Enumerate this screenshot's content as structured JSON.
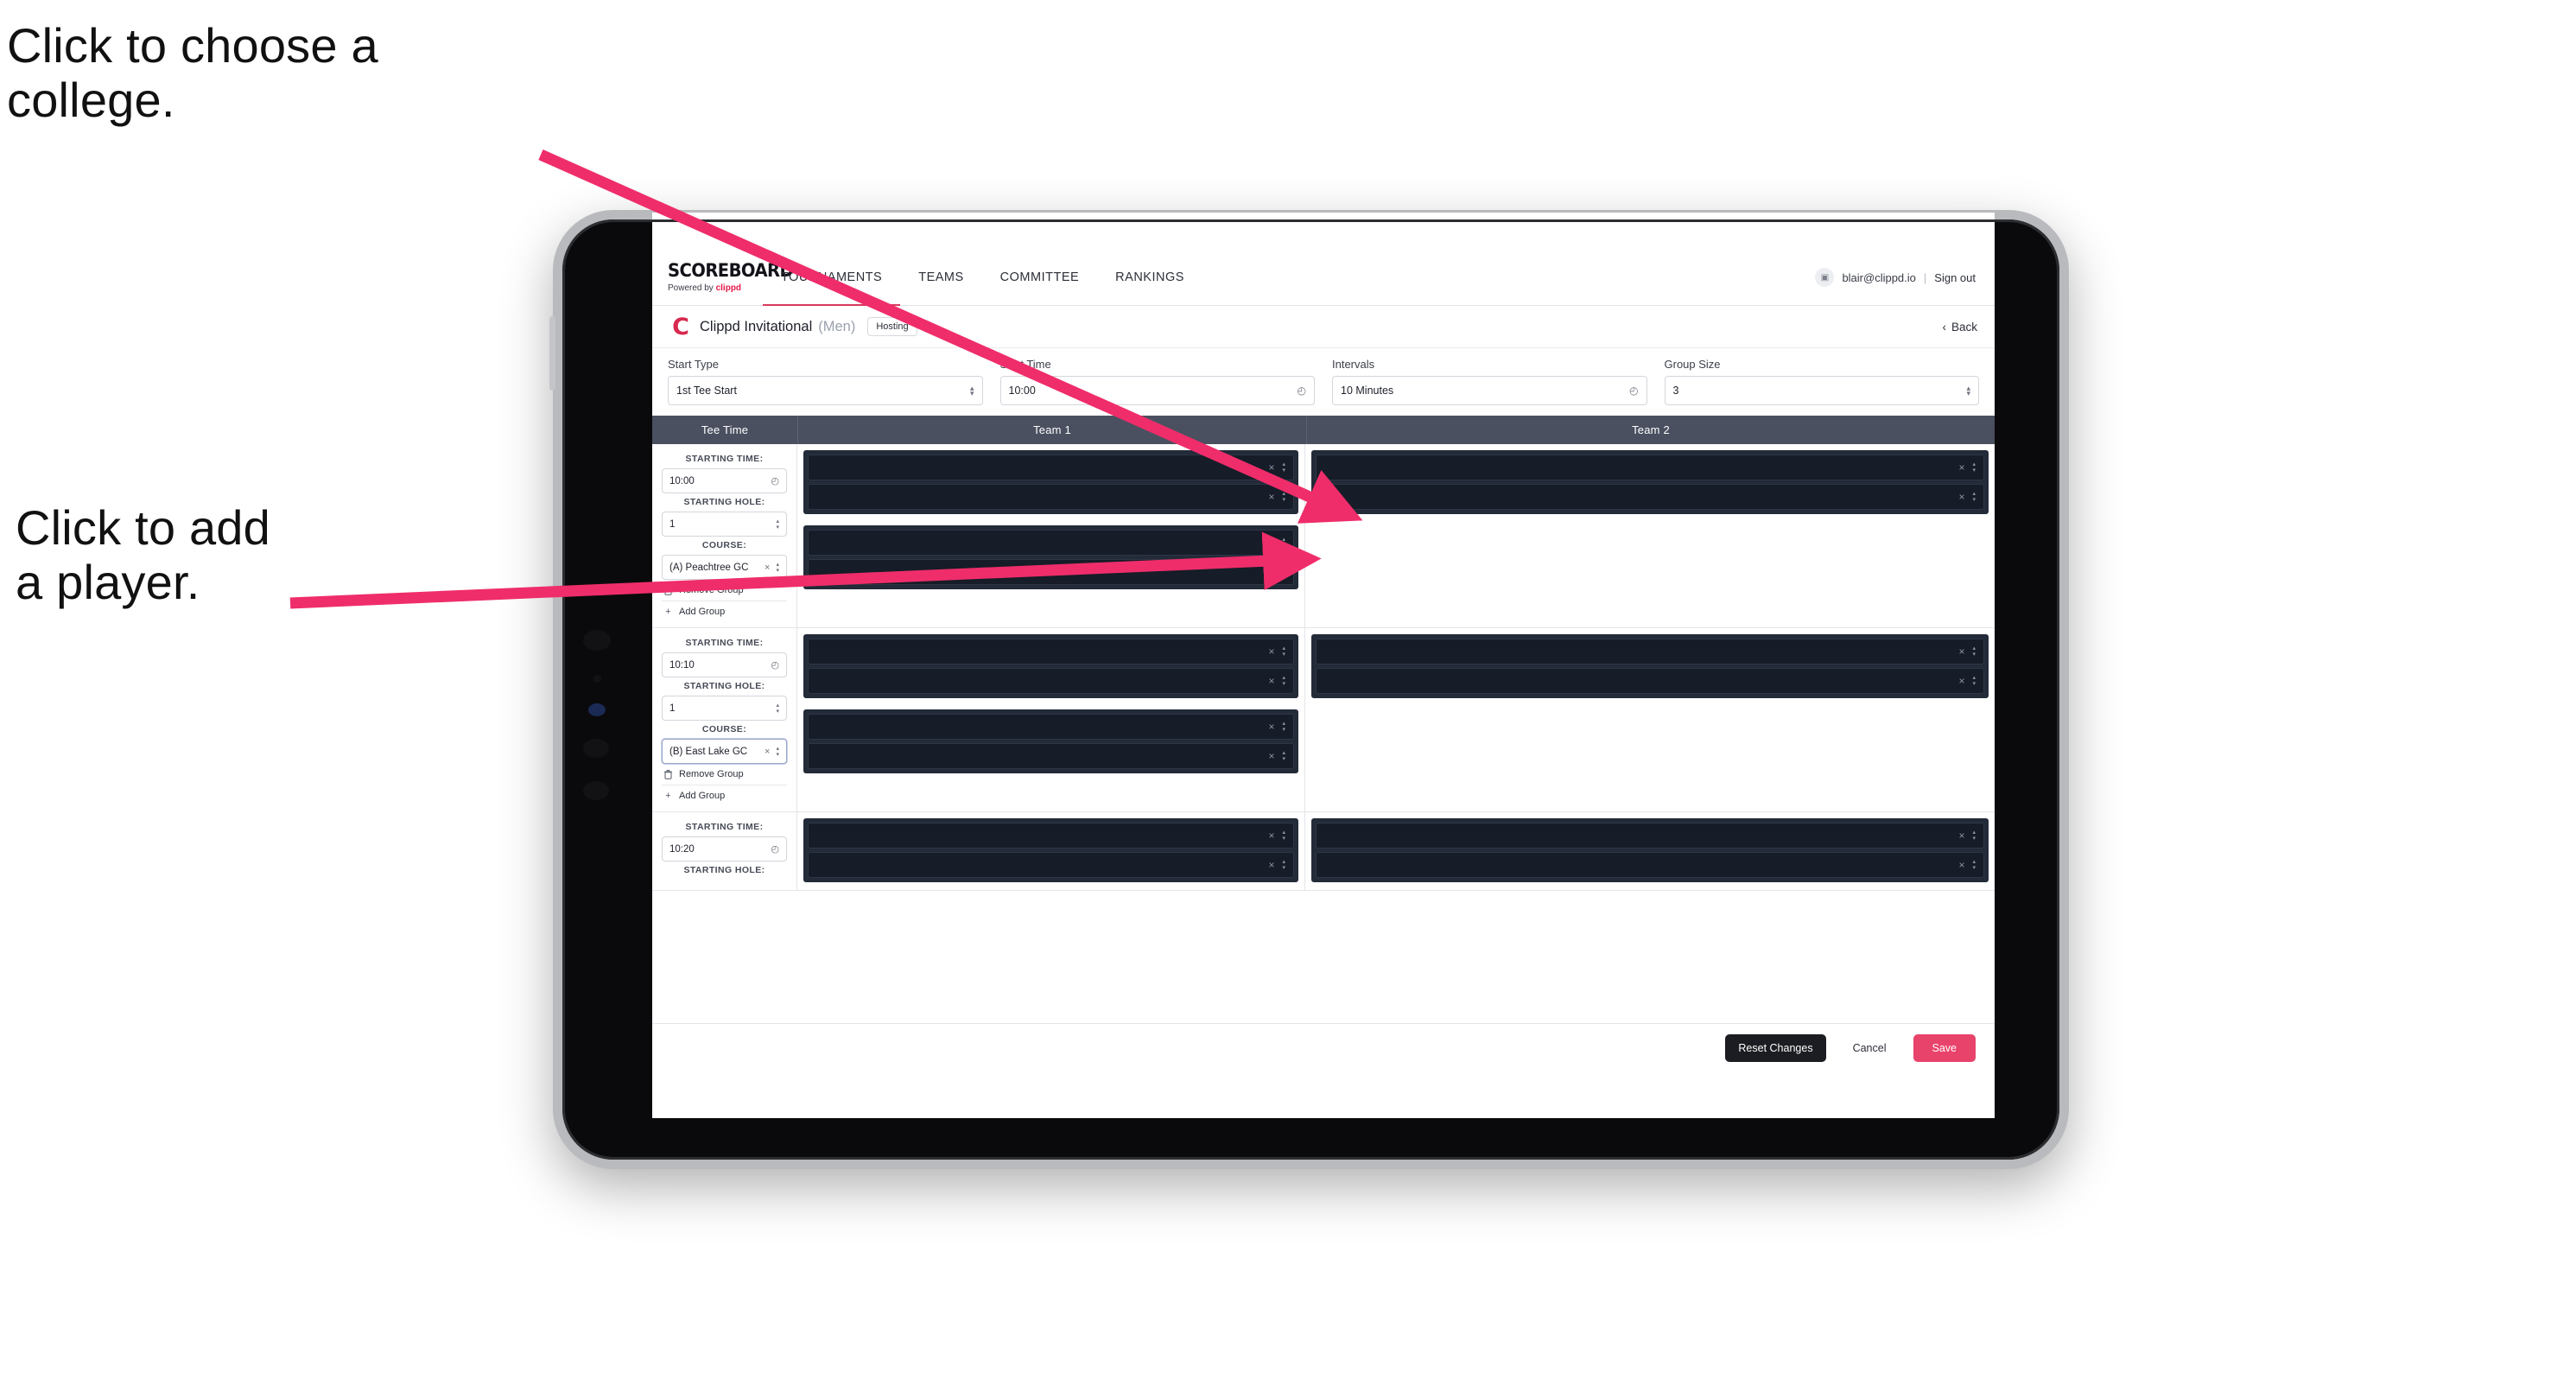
{
  "annotations": {
    "choose_college": "Click to choose a\ncollege.",
    "add_player": "Click to add\na player."
  },
  "colors": {
    "accent_pink": "#e8436b",
    "arrow_pink": "#ef2d6a",
    "header_slate": "#4a5060",
    "row_dark": "#232a38",
    "row_inner": "#161c28"
  },
  "topnav": {
    "brand_word": "SCOREBOARD",
    "brand_sub_prefix": "Powered by ",
    "brand_sub_name": "clippd",
    "tabs": [
      {
        "label": "TOURNAMENTS",
        "active": true
      },
      {
        "label": "TEAMS",
        "active": false
      },
      {
        "label": "COMMITTEE",
        "active": false
      },
      {
        "label": "RANKINGS",
        "active": false
      }
    ],
    "avatar_icon": "user-avatar-icon",
    "user_email": "blair@clippd.io",
    "separator": "|",
    "sign_out": "Sign out"
  },
  "title_row": {
    "logo_letter": "C",
    "tournament_name": "Clippd Invitational",
    "gender": "(Men)",
    "badge": "Hosting",
    "back_chevron": "‹",
    "back_label": "Back"
  },
  "controls": [
    {
      "label": "Start Type",
      "value": "1st Tee Start",
      "icon": "chevron-updown-icon"
    },
    {
      "label": "Start Time",
      "value": "10:00",
      "icon": "clock-icon"
    },
    {
      "label": "Intervals",
      "value": "10 Minutes",
      "icon": "clock-icon"
    },
    {
      "label": "Group Size",
      "value": "3",
      "icon": "chevron-updown-icon"
    }
  ],
  "table": {
    "columns": [
      "Tee Time",
      "Team 1",
      "Team 2"
    ],
    "labels": {
      "starting_time": "STARTING TIME:",
      "starting_hole": "STARTING HOLE:",
      "course": "COURSE:",
      "remove_group": "Remove Group",
      "add_group": "Add Group",
      "trash_icon": "trash-icon",
      "plus_icon": "plus-icon",
      "clock_icon": "clock-icon",
      "stepper_icon": "chevron-updown-icon",
      "clear_icon": "clear-x-icon"
    },
    "rows": [
      {
        "starting_time": "10:00",
        "starting_hole": "1",
        "course": "(A) Peachtree GC",
        "course_focused": false,
        "team1_groups": [
          2,
          2
        ],
        "team2_groups": [
          2
        ]
      },
      {
        "starting_time": "10:10",
        "starting_hole": "1",
        "course": "(B) East Lake GC",
        "course_focused": true,
        "team1_groups": [
          2,
          2
        ],
        "team2_groups": [
          2
        ]
      },
      {
        "starting_time": "10:20",
        "starting_hole": "",
        "course": "",
        "course_focused": false,
        "team1_groups": [
          2
        ],
        "team2_groups": [
          2
        ]
      }
    ]
  },
  "footer": {
    "reset": "Reset Changes",
    "cancel": "Cancel",
    "save": "Save"
  },
  "player_row": {
    "remove_icon": "clear-x-icon",
    "reorder_icon": "chevron-updown-icon"
  }
}
